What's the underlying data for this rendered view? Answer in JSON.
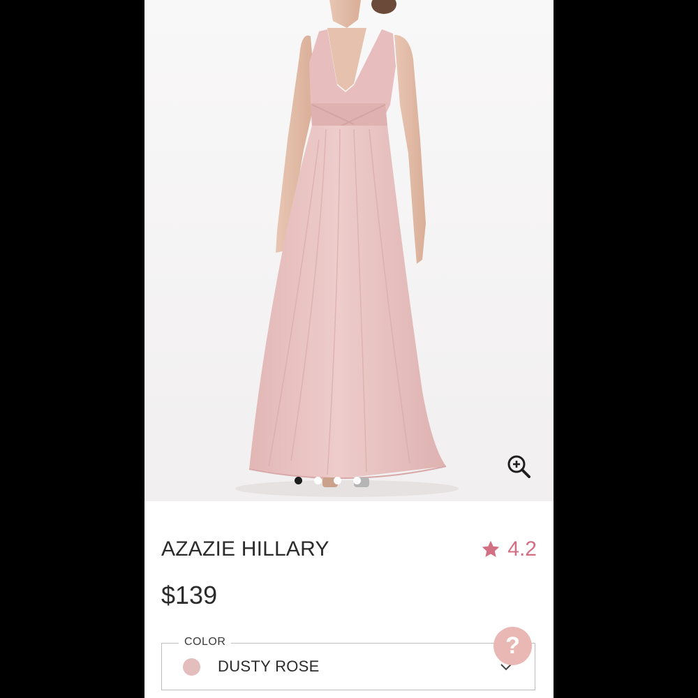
{
  "product": {
    "name": "AZAZIE HILLARY",
    "price": "$139",
    "rating": "4.2"
  },
  "gallery": {
    "image_count": 4,
    "active_index": 0
  },
  "color_picker": {
    "legend": "COLOR",
    "selected": "DUSTY ROSE",
    "swatch_color": "#e4bdbd"
  },
  "help": {
    "label": "?"
  },
  "colors": {
    "accent": "#d26f82",
    "dress": "#e9c2c1",
    "help_button": "#eab8b4",
    "text": "#2b2b2b"
  },
  "icons": {
    "zoom": "zoom-in-icon",
    "rating": "star-icon",
    "dropdown": "chevron-down-icon"
  }
}
